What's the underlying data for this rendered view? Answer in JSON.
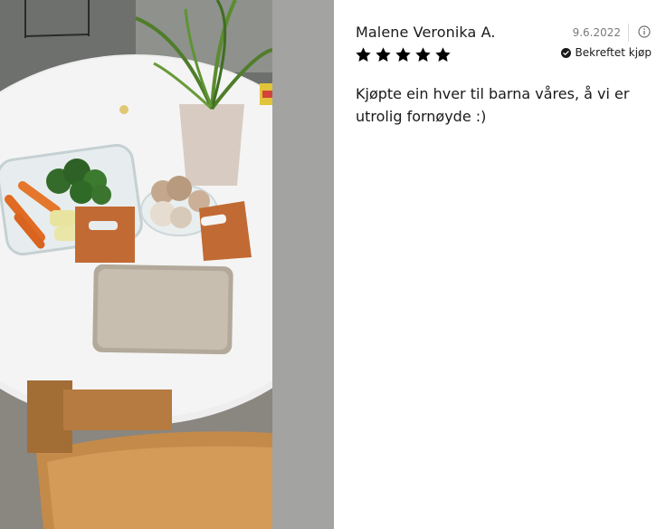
{
  "review": {
    "reviewer_name": "Malene Veronika A.",
    "date": "9.6.2022",
    "rating": 5,
    "rating_max": 5,
    "verified_label": "Bekreftet kjøp",
    "text": "Kjøpte ein hver til barna våres, å vi er utrolig fornøyde :)"
  },
  "icons": {
    "info": "info-icon",
    "star": "star-icon",
    "verified": "check-circle-icon"
  },
  "colors": {
    "star": "#000000",
    "text": "#1a1a1a",
    "muted": "#7a7a7a"
  }
}
